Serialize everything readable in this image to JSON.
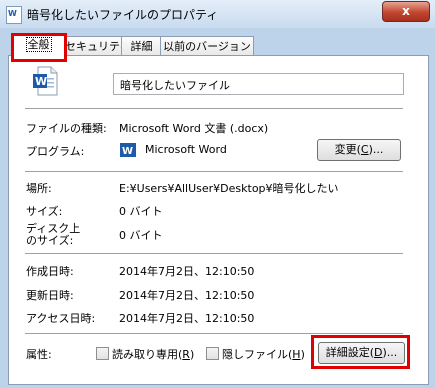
{
  "window": {
    "title": "暗号化したいファイルのプロパティ",
    "close_label": "x"
  },
  "tabs": [
    {
      "label": "全般"
    },
    {
      "label": "セキュリティ"
    },
    {
      "label": "詳細"
    },
    {
      "label": "以前のバージョン"
    }
  ],
  "general": {
    "file_name": "暗号化したいファイル",
    "file_type_label": "ファイルの種類:",
    "file_type_value": "Microsoft Word 文書 (.docx)",
    "program_label": "プログラム:",
    "program_value": "Microsoft Word",
    "change_button": {
      "text": "変更(",
      "mnemonic": "C",
      "suffix": ")..."
    },
    "location_label": "場所:",
    "location_value": "E:¥Users¥AllUser¥Desktop¥暗号化したい",
    "size_label": "サイズ:",
    "size_value": "0 バイト",
    "disk_size_label_line1": "ディスク上",
    "disk_size_label_line2": "のサイズ:",
    "disk_size_value": "0 バイト",
    "created_label": "作成日時:",
    "created_value": "2014年7月2日、12:10:50",
    "modified_label": "更新日時:",
    "modified_value": "2014年7月2日、12:10:50",
    "accessed_label": "アクセス日時:",
    "accessed_value": "2014年7月2日、12:10:50",
    "attributes_label": "属性:",
    "readonly": {
      "label": "読み取り専用(",
      "mnemonic": "R",
      "suffix": ")",
      "checked": false
    },
    "hidden": {
      "label": "隠しファイル(",
      "mnemonic": "H",
      "suffix": ")",
      "checked": false
    },
    "advanced_button": {
      "text": "詳細設定(",
      "mnemonic": "D",
      "suffix": ")..."
    }
  },
  "colors": {
    "highlight": "#e00000",
    "word_blue": "#1f5aa8"
  },
  "icons": {
    "title": "word-document-icon",
    "file": "word-document-icon",
    "program": "word-program-icon"
  }
}
